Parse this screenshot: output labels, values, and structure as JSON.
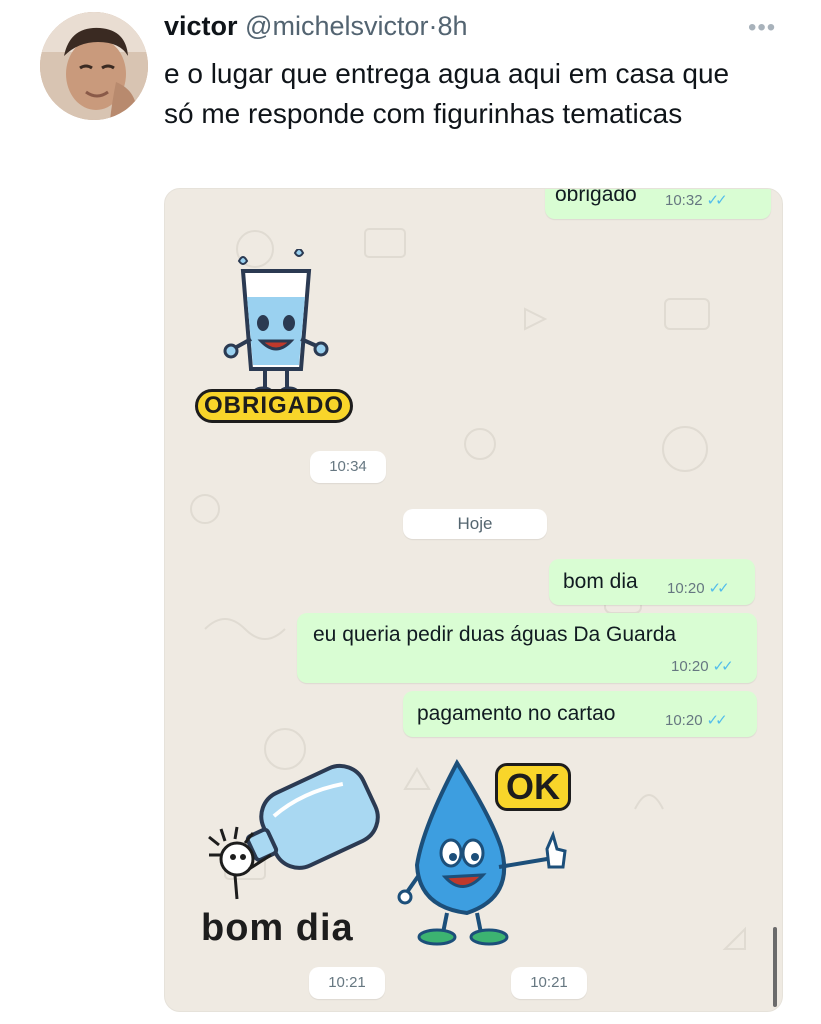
{
  "tweet": {
    "name": "victor",
    "handle": "@michelsvictor",
    "separator": "·",
    "time": "8h",
    "more_icon": "more-dots-icon",
    "text": "e o lugar que entrega agua aqui em casa que só me responde com figurinhas tematicas"
  },
  "chat": {
    "top_message": {
      "text": "obrigado",
      "time": "10:32"
    },
    "sticker_obrigado": {
      "caption": "OBRIGADO",
      "time": "10:34"
    },
    "date_separator": "Hoje",
    "messages": [
      {
        "text": "bom dia",
        "time": "10:20"
      },
      {
        "text": "eu queria pedir duas águas Da Guarda",
        "time": "10:20"
      },
      {
        "text": "pagamento no cartao",
        "time": "10:20"
      }
    ],
    "sticker_bom_dia": {
      "caption": "bom dia",
      "time": "10:21"
    },
    "sticker_ok": {
      "caption": "OK",
      "time": "10:21"
    },
    "colors": {
      "outgoing_bubble": "#d9fdd3",
      "background": "#efeae2",
      "read_ticks": "#53bdeb"
    }
  }
}
